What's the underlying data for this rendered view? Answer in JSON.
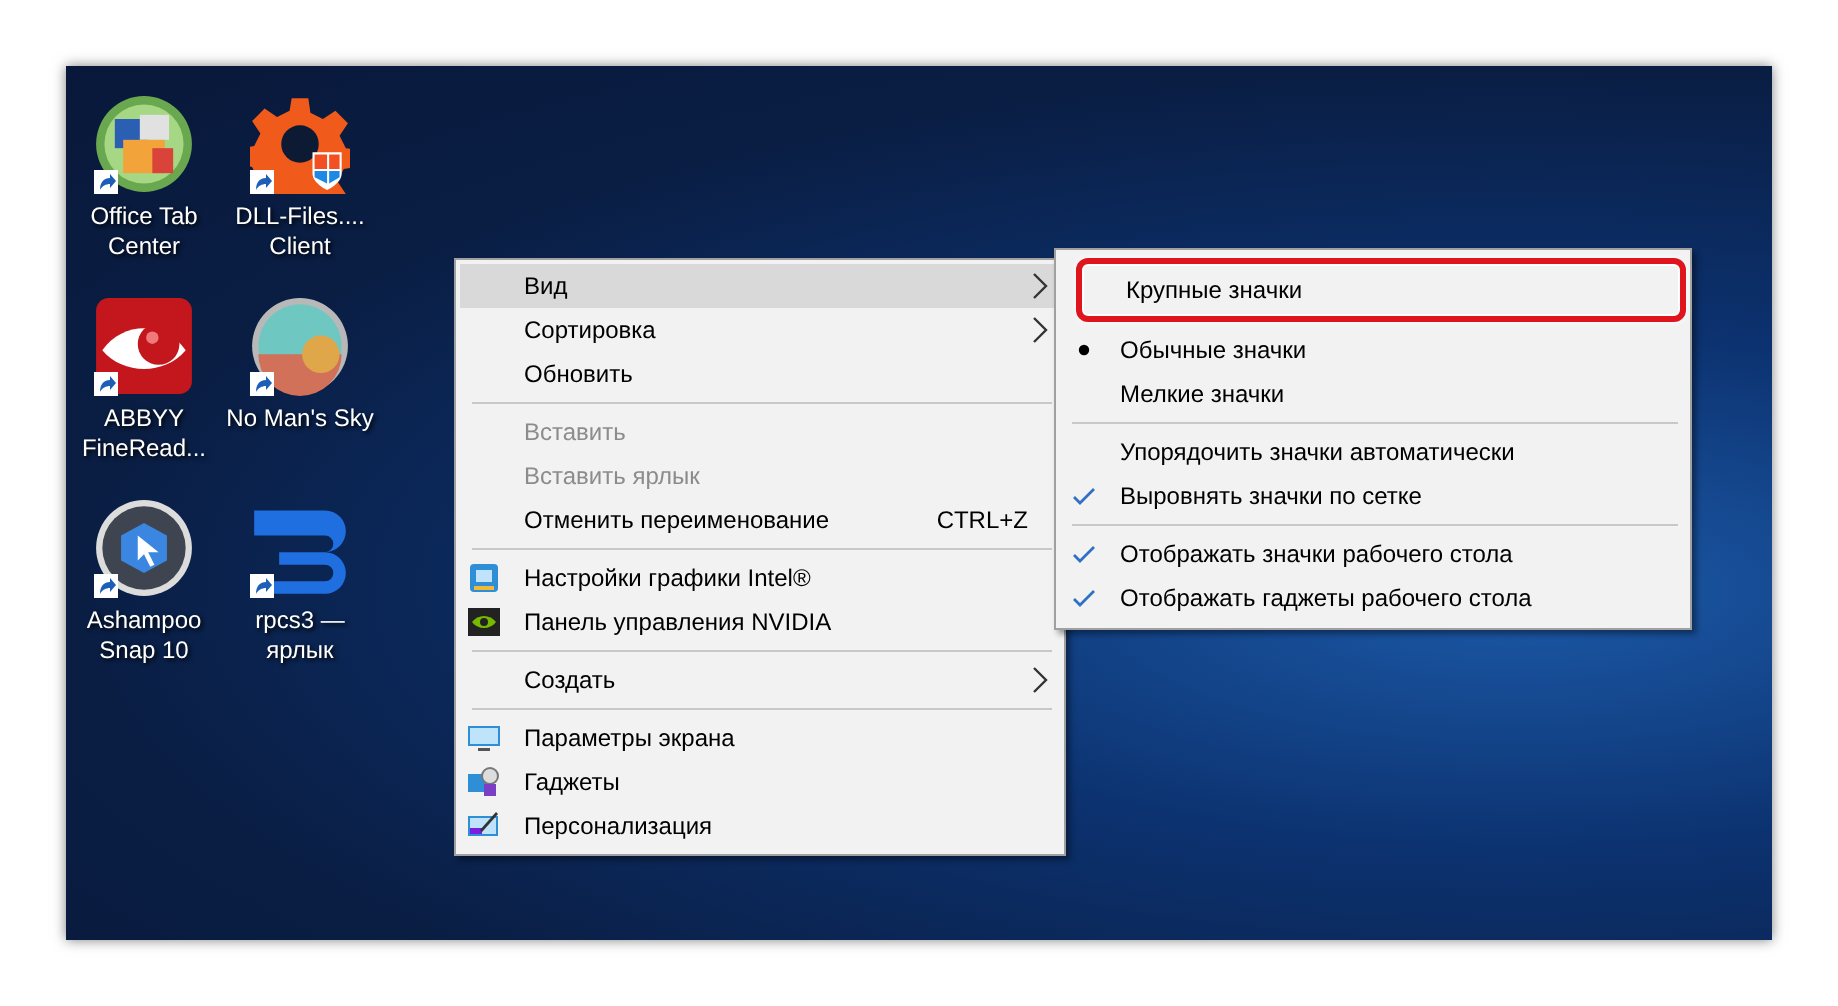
{
  "desktop": {
    "icons": [
      {
        "kind": "office",
        "lines": [
          "Office Tab",
          "Center"
        ],
        "shortcut": true
      },
      {
        "kind": "dll",
        "lines": [
          "DLL-Files....",
          "Client"
        ],
        "shortcut": true
      },
      {
        "kind": "abbyy",
        "lines": [
          "ABBYY",
          "FineRead..."
        ],
        "shortcut": true
      },
      {
        "kind": "nms",
        "lines": [
          "No Man's Sky"
        ],
        "shortcut": true
      },
      {
        "kind": "ashampoo",
        "lines": [
          "Ashampoo",
          "Snap 10"
        ],
        "shortcut": true
      },
      {
        "kind": "rpcs3",
        "lines": [
          "rpcs3 —",
          "ярлык"
        ],
        "shortcut": true
      }
    ]
  },
  "context_menu": {
    "items": [
      {
        "kind": "item",
        "label": "Вид",
        "submenu": true,
        "selected": true,
        "disabled": false
      },
      {
        "kind": "item",
        "label": "Сортировка",
        "submenu": true,
        "selected": false,
        "disabled": false
      },
      {
        "kind": "item",
        "label": "Обновить",
        "submenu": false,
        "selected": false,
        "disabled": false
      },
      {
        "kind": "separator"
      },
      {
        "kind": "item",
        "label": "Вставить",
        "submenu": false,
        "selected": false,
        "disabled": true
      },
      {
        "kind": "item",
        "label": "Вставить ярлык",
        "submenu": false,
        "selected": false,
        "disabled": true
      },
      {
        "kind": "item",
        "label": "Отменить переименование",
        "shortcut": "CTRL+Z",
        "submenu": false,
        "selected": false,
        "disabled": false
      },
      {
        "kind": "separator"
      },
      {
        "kind": "intel",
        "label": "Настройки графики Intel®",
        "submenu": false,
        "selected": false,
        "disabled": false
      },
      {
        "kind": "nvidia",
        "label": "Панель управления NVIDIA",
        "submenu": false,
        "selected": false,
        "disabled": false
      },
      {
        "kind": "separator"
      },
      {
        "kind": "item",
        "label": "Создать",
        "submenu": true,
        "selected": false,
        "disabled": false
      },
      {
        "kind": "separator"
      },
      {
        "kind": "display",
        "label": "Параметры экрана",
        "submenu": false,
        "selected": false,
        "disabled": false
      },
      {
        "kind": "gadgets",
        "label": "Гаджеты",
        "submenu": false,
        "selected": false,
        "disabled": false
      },
      {
        "kind": "personalize",
        "label": "Персонализация",
        "submenu": false,
        "selected": false,
        "disabled": false
      }
    ]
  },
  "view_submenu": {
    "items": [
      {
        "kind": "radio",
        "label": "Крупные значки",
        "checked": false,
        "highlighted": true
      },
      {
        "kind": "radio",
        "label": "Обычные значки",
        "checked": true,
        "highlighted": false
      },
      {
        "kind": "radio",
        "label": "Мелкие значки",
        "checked": false,
        "highlighted": false
      },
      {
        "kind": "separator"
      },
      {
        "kind": "check",
        "label": "Упорядочить значки автоматически",
        "checked": false,
        "highlighted": false
      },
      {
        "kind": "check",
        "label": "Выровнять значки по сетке",
        "checked": true,
        "highlighted": false
      },
      {
        "kind": "separator"
      },
      {
        "kind": "check",
        "label": "Отображать значки рабочего стола",
        "checked": true,
        "highlighted": false
      },
      {
        "kind": "check",
        "label": "Отображать гаджеты  рабочего стола",
        "checked": true,
        "highlighted": false
      }
    ]
  }
}
